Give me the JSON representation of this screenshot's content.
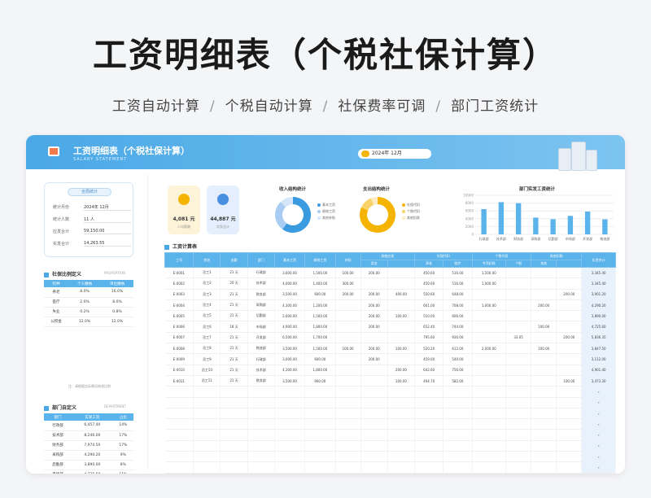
{
  "hero": {
    "title": "工资明细表（个税社保计算）",
    "features": [
      "工资自动计算",
      "个税自动计算",
      "社保费率可调",
      "部门工资统计"
    ],
    "separator": "/"
  },
  "app": {
    "title": "工资明细表（个税社保计算）",
    "subtitle": "SALARY STATEMENT",
    "date_label": "2024年  12月"
  },
  "summary": {
    "pill": "全局统计",
    "rows": [
      {
        "label": "統计月份",
        "value": "2024年    12月"
      },
      {
        "label": "统计人数",
        "value": "11 人"
      },
      {
        "label": "应发合计",
        "value": "59,150.00"
      },
      {
        "label": "实发合计",
        "value": "14,263.55"
      }
    ]
  },
  "ratio": {
    "title": "社保比例定义",
    "en": "PROPORTION",
    "headers": [
      "险种",
      "个人缴纳",
      "单位缴纳"
    ],
    "rows": [
      [
        "养老",
        "8.0%",
        "16.0%"
      ],
      [
        "医疗",
        "2.0%",
        "8.0%"
      ],
      [
        "失业",
        "0.2%",
        "0.8%"
      ],
      [
        "公积金",
        "12.0%",
        "12.0%"
      ]
    ],
    "note": "注：请根据实际情况修改比例"
  },
  "dept": {
    "title": "部门自定义",
    "en": "DEPARTMENT",
    "headers": [
      "部门",
      "实发工资",
      "占比"
    ],
    "rows": [
      [
        "行政部",
        "6,457.40",
        "14%"
      ],
      [
        "技术部",
        "8,246.00",
        "17%"
      ],
      [
        "财务部",
        "7,974.50",
        "17%"
      ],
      [
        "采购部",
        "4,290.20",
        "9%"
      ],
      [
        "后勤部",
        "3,890.00",
        "8%"
      ],
      [
        "市场部",
        "4,725.60",
        "11%"
      ],
      [
        "开发部",
        "5,836.35",
        "13%"
      ],
      [
        "物流部",
        "3,847.50",
        "8%"
      ]
    ]
  },
  "kpi": [
    {
      "value": "4,081 元",
      "label": "人均薪酬",
      "color": "#f5b400",
      "bg": "#fdf3d8"
    },
    {
      "value": "44,887 元",
      "label": "实发总计",
      "color": "#4a90e2",
      "bg": "#e4eefc"
    }
  ],
  "income_chart": {
    "title": "收入结构统计",
    "legend": [
      "基本工资",
      "绩效工资",
      "其他补贴"
    ],
    "colors": [
      "#3b9be0",
      "#a9cdf2",
      "#d5e6f8"
    ],
    "values": [
      60,
      28,
      12
    ]
  },
  "expense_chart": {
    "title": "支出结构统计",
    "legend": [
      "社保代扣",
      "个税代扣",
      "其他扣款"
    ],
    "colors": [
      "#f5b400",
      "#f9d36a",
      "#fcecc2"
    ],
    "values": [
      82,
      12,
      6
    ]
  },
  "chart_data": {
    "type": "bar",
    "title": "部门实发工资统计",
    "categories": [
      "行政部",
      "技术部",
      "财务部",
      "采购部",
      "后勤部",
      "市场部",
      "开发部",
      "物流部"
    ],
    "values": [
      6457.4,
      8246,
      7974.5,
      4290.2,
      3890,
      4725.6,
      5836.35,
      3847.5
    ],
    "ylim": [
      0,
      10000
    ],
    "yticks": [
      "10000",
      "8000",
      "6000",
      "4000",
      "2000",
      "0"
    ],
    "color": "#5ab3ea"
  },
  "table": {
    "title": "工资计算表",
    "group_headers": [
      "工号",
      "姓名",
      "出勤",
      "部门",
      "基本工资",
      "绩效工资",
      "补贴",
      "其他应发",
      "社保代扣",
      "个税代扣",
      "其他扣款",
      "实发合计"
    ],
    "sub_headers": [
      "",
      "",
      "",
      "",
      "",
      "",
      "",
      "奖金",
      "",
      "养老",
      "医疗",
      "专项扣除",
      "个税",
      "其他",
      "",
      ""
    ],
    "rows": [
      [
        "E-0001",
        "员工1",
        "21 天",
        "行政部",
        "3,600.00",
        "1,500.00",
        "100.00",
        "200.00",
        "",
        "450.60",
        "516.00",
        "1,500.00",
        "",
        "",
        "",
        "3,345.40"
      ],
      [
        "E-0002",
        "员工2",
        "20 天",
        "技术部",
        "4,000.00",
        "1,400.00",
        "300.00",
        "",
        "",
        "450.60",
        "516.00",
        "1,000.00",
        "",
        "",
        "",
        "3,345.40"
      ],
      [
        "E-0003",
        "员工3",
        "21 天",
        "财务部",
        "3,500.00",
        "600.00",
        "200.00",
        "200.00",
        "400.00",
        "550.60",
        "648.00",
        "",
        "",
        "",
        "200.00",
        "3,901.20"
      ],
      [
        "E-0004",
        "员工4",
        "21 天",
        "采购部",
        "4,300.00",
        "1,200.00",
        "",
        "200.00",
        "",
        "601.00",
        "708.00",
        "1,000.00",
        "",
        "200.00",
        "",
        "4,290.20"
      ],
      [
        "E-0005",
        "员工5",
        "21 天",
        "后勤部",
        "2,600.00",
        "1,500.00",
        "",
        "200.00",
        "100.00",
        "510.00",
        "606.00",
        "",
        "",
        "",
        "",
        "3,890.00"
      ],
      [
        "E-0006",
        "员工6",
        "18 天",
        "市场部",
        "4,900.00",
        "1,800.00",
        "",
        "200.00",
        "",
        "652.40",
        "744.00",
        "",
        "",
        "100.00",
        "",
        "4,725.60"
      ],
      [
        "E-0007",
        "员工7",
        "21 天",
        "开发部",
        "6,500.00",
        "1,700.00",
        "",
        "",
        "",
        "795.60",
        "936.00",
        "",
        "33.05",
        "",
        "200.00",
        "5,836.35"
      ],
      [
        "E-0008",
        "员工8",
        "21 天",
        "物流部",
        "3,500.00",
        "1,500.00",
        "100.00",
        "200.00",
        "100.00",
        "520.20",
        "612.00",
        "2,000.00",
        "",
        "100.00",
        "",
        "3,847.50"
      ],
      [
        "E-0009",
        "员工9",
        "21 天",
        "行政部",
        "3,000.00",
        "600.00",
        "",
        "200.00",
        "",
        "459.00",
        "540.00",
        "",
        "",
        "",
        "",
        "3,112.00"
      ],
      [
        "E-0010",
        "员工10",
        "21 天",
        "技术部",
        "4,300.00",
        "1,800.00",
        "",
        "",
        "200.00",
        "642.60",
        "756.00",
        "",
        "",
        "",
        "",
        "4,901.40"
      ],
      [
        "E-0011",
        "员工11",
        "21 天",
        "财务部",
        "3,500.00",
        "900.00",
        "",
        "",
        "100.00",
        "494.70",
        "582.00",
        "",
        "",
        "",
        "100.00",
        "3,473.30"
      ]
    ],
    "empty_rows": 8,
    "scroll_glyph": "▾"
  }
}
